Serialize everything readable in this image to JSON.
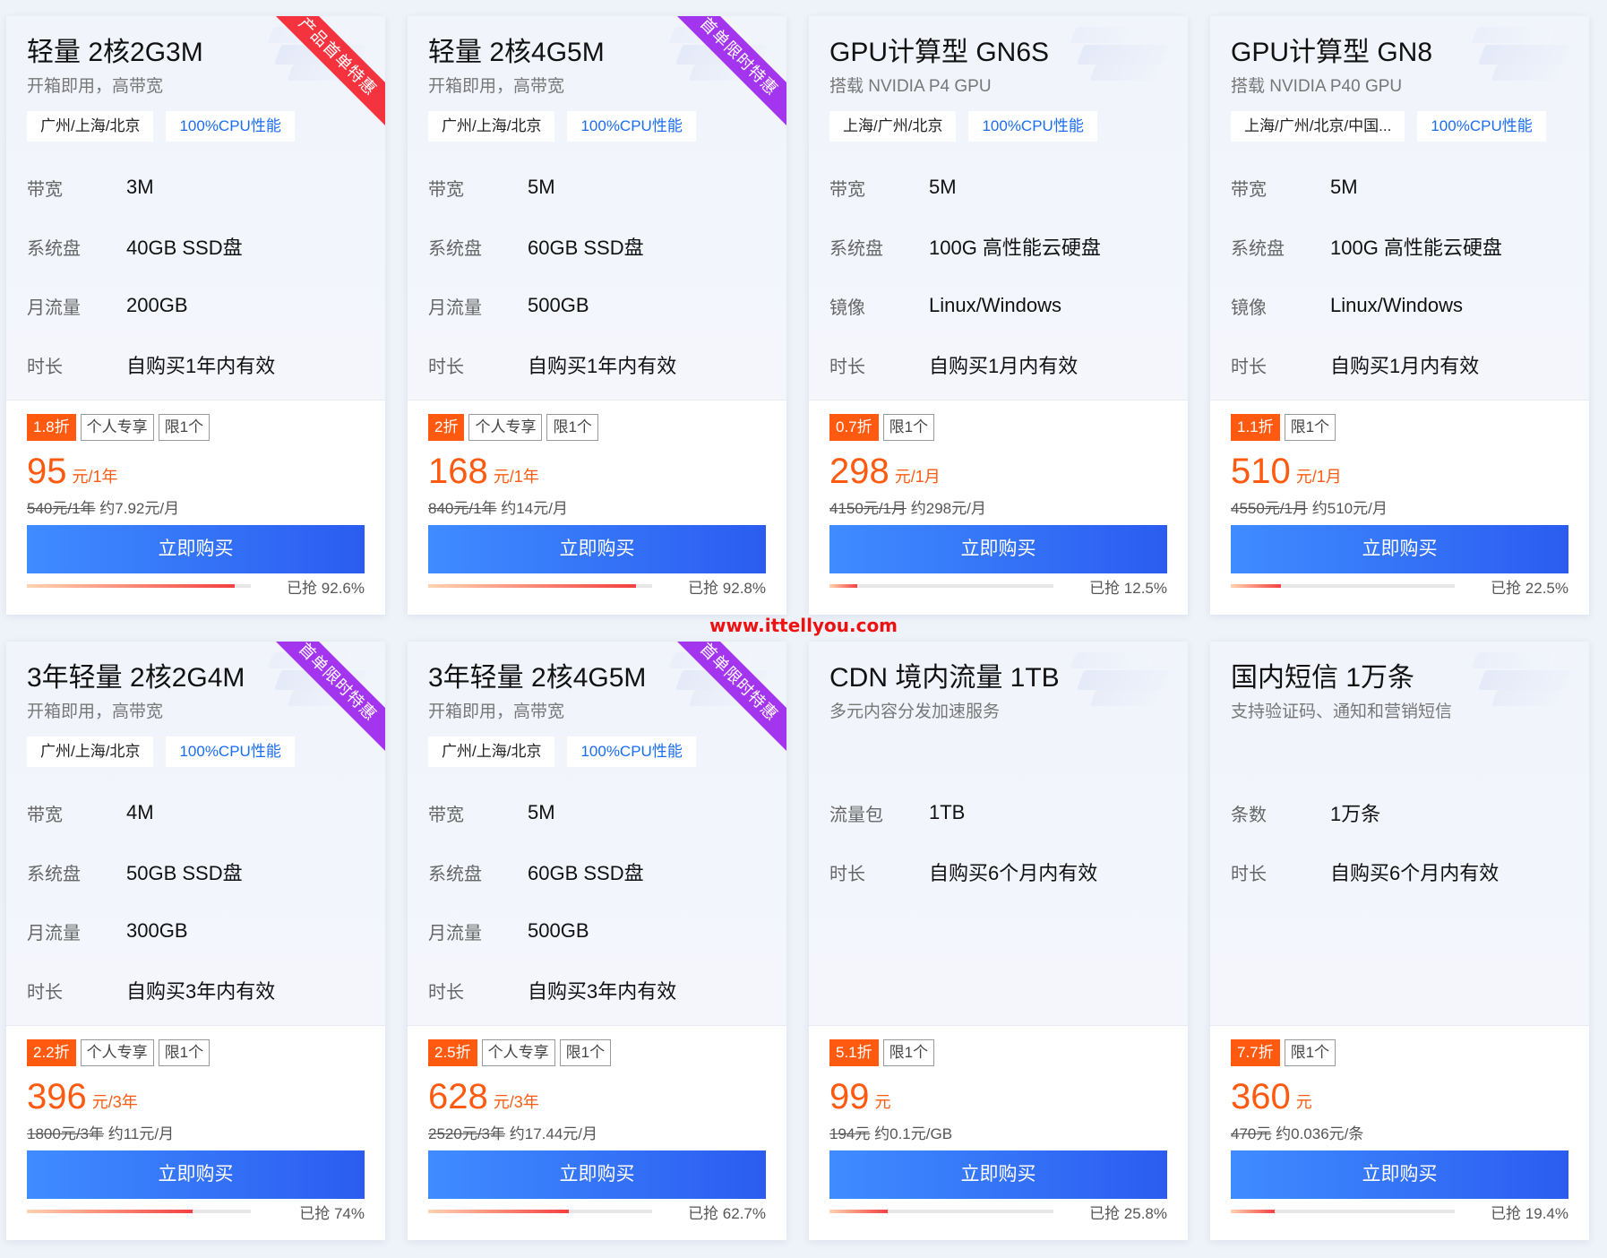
{
  "cards": [
    {
      "title": "轻量 2核2G3M",
      "subtitle": "开箱即用，高带宽",
      "ribbon": "产品首单特惠",
      "ribbon_color": "red",
      "tags": [
        "广州/上海/北京",
        "100%CPU性能"
      ],
      "specs": [
        {
          "k": "带宽",
          "v": "3M"
        },
        {
          "k": "系统盘",
          "v": "40GB SSD盘"
        },
        {
          "k": "月流量",
          "v": "200GB"
        },
        {
          "k": "时长",
          "v": "自购买1年内有效"
        }
      ],
      "badges": [
        "1.8折",
        "个人专享",
        "限1个"
      ],
      "price": "95",
      "unit": "元/1年",
      "original": "540元/1年",
      "approx": "约7.92元/月",
      "buy_label": "立即购买",
      "progress": 0.926,
      "sold_text": "已抢 92.6%"
    },
    {
      "title": "轻量 2核4G5M",
      "subtitle": "开箱即用，高带宽",
      "ribbon": "首单限时特惠",
      "ribbon_color": "purple",
      "tags": [
        "广州/上海/北京",
        "100%CPU性能"
      ],
      "specs": [
        {
          "k": "带宽",
          "v": "5M"
        },
        {
          "k": "系统盘",
          "v": "60GB SSD盘"
        },
        {
          "k": "月流量",
          "v": "500GB"
        },
        {
          "k": "时长",
          "v": "自购买1年内有效"
        }
      ],
      "badges": [
        "2折",
        "个人专享",
        "限1个"
      ],
      "price": "168",
      "unit": "元/1年",
      "original": "840元/1年",
      "approx": "约14元/月",
      "buy_label": "立即购买",
      "progress": 0.928,
      "sold_text": "已抢 92.8%"
    },
    {
      "title": "GPU计算型 GN6S",
      "subtitle": "搭载 NVIDIA P4 GPU",
      "ribbon": "",
      "ribbon_color": "",
      "tags": [
        "上海/广州/北京",
        "100%CPU性能"
      ],
      "specs": [
        {
          "k": "带宽",
          "v": "5M"
        },
        {
          "k": "系统盘",
          "v": "100G 高性能云硬盘"
        },
        {
          "k": "镜像",
          "v": "Linux/Windows"
        },
        {
          "k": "时长",
          "v": "自购买1月内有效"
        }
      ],
      "badges": [
        "0.7折",
        "限1个"
      ],
      "price": "298",
      "unit": "元/1月",
      "original": "4150元/1月",
      "approx": "约298元/月",
      "buy_label": "立即购买",
      "progress": 0.125,
      "sold_text": "已抢 12.5%"
    },
    {
      "title": "GPU计算型 GN8",
      "subtitle": "搭载 NVIDIA P40 GPU",
      "ribbon": "",
      "ribbon_color": "",
      "tags": [
        "上海/广州/北京/中国...",
        "100%CPU性能"
      ],
      "specs": [
        {
          "k": "带宽",
          "v": "5M"
        },
        {
          "k": "系统盘",
          "v": "100G 高性能云硬盘"
        },
        {
          "k": "镜像",
          "v": "Linux/Windows"
        },
        {
          "k": "时长",
          "v": "自购买1月内有效"
        }
      ],
      "badges": [
        "1.1折",
        "限1个"
      ],
      "price": "510",
      "unit": "元/1月",
      "original": "4550元/1月",
      "approx": "约510元/月",
      "buy_label": "立即购买",
      "progress": 0.225,
      "sold_text": "已抢 22.5%"
    },
    {
      "title": "3年轻量 2核2G4M",
      "subtitle": "开箱即用，高带宽",
      "ribbon": "首单限时特惠",
      "ribbon_color": "purple",
      "tags": [
        "广州/上海/北京",
        "100%CPU性能"
      ],
      "specs": [
        {
          "k": "带宽",
          "v": "4M"
        },
        {
          "k": "系统盘",
          "v": "50GB SSD盘"
        },
        {
          "k": "月流量",
          "v": "300GB"
        },
        {
          "k": "时长",
          "v": "自购买3年内有效"
        }
      ],
      "badges": [
        "2.2折",
        "个人专享",
        "限1个"
      ],
      "price": "396",
      "unit": "元/3年",
      "original": "1800元/3年",
      "approx": "约11元/月",
      "buy_label": "立即购买",
      "progress": 0.74,
      "sold_text": "已抢 74%"
    },
    {
      "title": "3年轻量 2核4G5M",
      "subtitle": "开箱即用，高带宽",
      "ribbon": "首单限时特惠",
      "ribbon_color": "purple",
      "tags": [
        "广州/上海/北京",
        "100%CPU性能"
      ],
      "specs": [
        {
          "k": "带宽",
          "v": "5M"
        },
        {
          "k": "系统盘",
          "v": "60GB SSD盘"
        },
        {
          "k": "月流量",
          "v": "500GB"
        },
        {
          "k": "时长",
          "v": "自购买3年内有效"
        }
      ],
      "badges": [
        "2.5折",
        "个人专享",
        "限1个"
      ],
      "price": "628",
      "unit": "元/3年",
      "original": "2520元/3年",
      "approx": "约17.44元/月",
      "buy_label": "立即购买",
      "progress": 0.627,
      "sold_text": "已抢 62.7%"
    },
    {
      "title": "CDN 境内流量 1TB",
      "subtitle": "多元内容分发加速服务",
      "ribbon": "",
      "ribbon_color": "",
      "tags": [],
      "specs": [
        {
          "k": "流量包",
          "v": "1TB"
        },
        {
          "k": "时长",
          "v": "自购买6个月内有效"
        }
      ],
      "badges": [
        "5.1折",
        "限1个"
      ],
      "price": "99",
      "unit": "元",
      "original": "194元",
      "approx": "约0.1元/GB",
      "buy_label": "立即购买",
      "progress": 0.258,
      "sold_text": "已抢 25.8%"
    },
    {
      "title": "国内短信 1万条",
      "subtitle": "支持验证码、通知和营销短信",
      "ribbon": "",
      "ribbon_color": "",
      "tags": [],
      "specs": [
        {
          "k": "条数",
          "v": "1万条"
        },
        {
          "k": "时长",
          "v": "自购买6个月内有效"
        }
      ],
      "badges": [
        "7.7折",
        "限1个"
      ],
      "price": "360",
      "unit": "元",
      "original": "470元",
      "approx": "约0.036元/条",
      "buy_label": "立即购买",
      "progress": 0.194,
      "sold_text": "已抢 19.4%"
    }
  ],
  "watermark": "www.ittellyou.com"
}
